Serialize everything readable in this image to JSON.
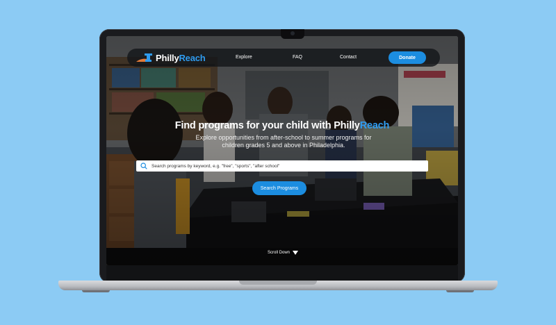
{
  "brand": {
    "name_part1": "Philly",
    "name_part2": "Reach",
    "accent_color": "#2f9cf0",
    "icon": "liberty-bell-logo-icon"
  },
  "nav": {
    "explore": "Explore",
    "faq": "FAQ",
    "contact": "Contact",
    "donate": "Donate"
  },
  "hero": {
    "title_part1": "Find programs for your child with Philly",
    "title_part2": "Reach",
    "subtitle": "Explore opportunities from after-school to summer programs for children grades 5 and above in Philadelphia."
  },
  "search": {
    "placeholder": "Search programs by keyword, e.g. \"free\", \"sports\", \"after school\"",
    "icon": "search-icon",
    "button_label": "Search Programs"
  },
  "scroll": {
    "label": "Scroll Down",
    "icon": "triangle-down-icon"
  },
  "colors": {
    "page_background": "#8ccbf4",
    "button_blue": "#1c8de0"
  }
}
